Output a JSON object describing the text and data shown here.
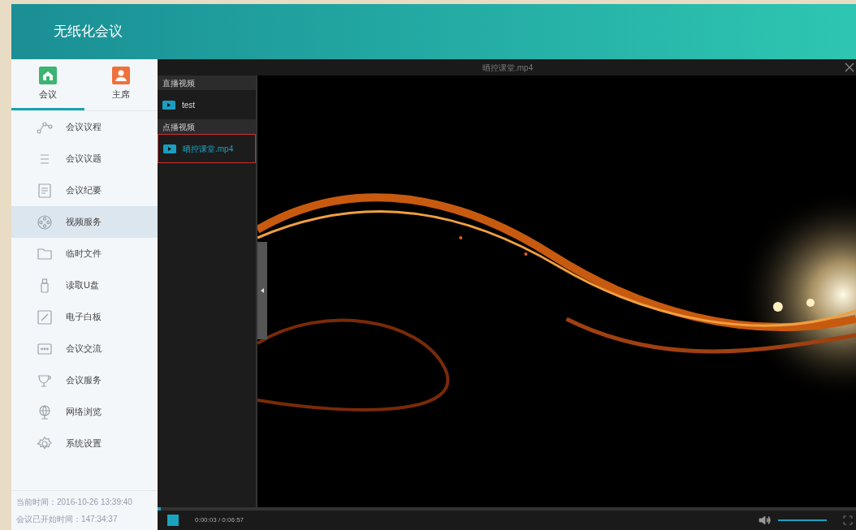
{
  "app": {
    "title": "无纸化会议"
  },
  "tabs": [
    {
      "label": "会议",
      "kind": "home",
      "selected": true
    },
    {
      "label": "主席",
      "kind": "person",
      "selected": false
    }
  ],
  "menu": [
    {
      "label": "会议议程",
      "kind": "flow",
      "selected": false
    },
    {
      "label": "会议议题",
      "kind": "list",
      "selected": false
    },
    {
      "label": "会议纪要",
      "kind": "notes",
      "selected": false
    },
    {
      "label": "视频服务",
      "kind": "film",
      "selected": true
    },
    {
      "label": "临时文件",
      "kind": "folder",
      "selected": false
    },
    {
      "label": "读取U盘",
      "kind": "usb",
      "selected": false
    },
    {
      "label": "电子白板",
      "kind": "board",
      "selected": false
    },
    {
      "label": "会议交流",
      "kind": "chat",
      "selected": false
    },
    {
      "label": "会议服务",
      "kind": "cup",
      "selected": false
    },
    {
      "label": "网络浏览",
      "kind": "globe",
      "selected": false
    },
    {
      "label": "系统设置",
      "kind": "gear",
      "selected": false
    }
  ],
  "status": [
    "当前时间：2016-10-26 13:39:40",
    "会议已开始时间：147:34:37"
  ],
  "player": {
    "title": "晒控课堂.mp4",
    "playlist": [
      {
        "heading": "直播视频",
        "items": [
          {
            "label": "test",
            "selected": false
          }
        ]
      },
      {
        "heading": "点播视频",
        "items": [
          {
            "label": "晒控课堂.mp4",
            "selected": true
          }
        ]
      }
    ],
    "progress": {
      "level": 0.005
    },
    "time": "0:00:03 / 0:06:57",
    "volume": {
      "level": 1
    }
  }
}
